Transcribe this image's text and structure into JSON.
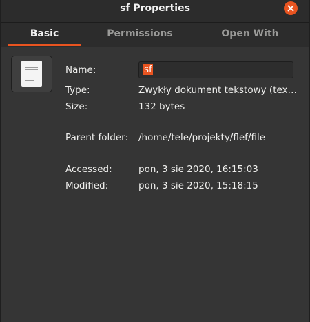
{
  "window": {
    "title": "sf Properties",
    "close_icon": "close-icon",
    "accent_color": "#e95420"
  },
  "tabs": [
    {
      "label": "Basic",
      "active": true
    },
    {
      "label": "Permissions",
      "active": false
    },
    {
      "label": "Open With",
      "active": false
    }
  ],
  "basic": {
    "icon": "text-document-icon",
    "name_label": "Name:",
    "name_value": "sf",
    "type_label": "Type:",
    "type_value": "Zwykły dokument tekstowy (text/plain)",
    "size_label": "Size:",
    "size_value": "132 bytes",
    "parent_label": "Parent folder:",
    "parent_value": "/home/tele/projekty/flef/file",
    "accessed_label": "Accessed:",
    "accessed_value": "pon, 3 sie 2020, 16:15:03",
    "modified_label": "Modified:",
    "modified_value": "pon, 3 sie 2020, 15:18:15"
  }
}
